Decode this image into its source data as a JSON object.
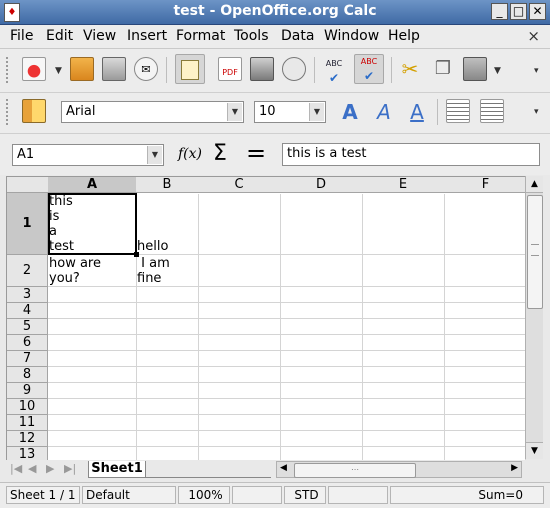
{
  "window": {
    "title": "test - OpenOffice.org Calc",
    "app_icon_label": "♦"
  },
  "menu": [
    "File",
    "Edit",
    "View",
    "Insert",
    "Format",
    "Tools",
    "Data",
    "Window",
    "Help"
  ],
  "menu_close": "×",
  "formatting": {
    "font_name": "Arial",
    "font_size": "10"
  },
  "formula_bar": {
    "name_box": "A1",
    "function_wizard_label": "f(x)",
    "sum_label": "Σ",
    "equals_label": "=",
    "input_value": "this is a test"
  },
  "columns": [
    "A",
    "B",
    "C",
    "D",
    "E",
    "F"
  ],
  "rows": [
    "1",
    "2",
    "3",
    "4",
    "5",
    "6",
    "7",
    "8",
    "9",
    "10",
    "11",
    "12",
    "13"
  ],
  "cells": {
    "A1": "this\nis\na\ntest",
    "B1": "hello",
    "A2": "how are\nyou?",
    "B2": " I am\nfine"
  },
  "sheet_tabs": [
    "Sheet1"
  ],
  "status": {
    "sheet": "Sheet 1 / 1",
    "page_style": "Default",
    "zoom": "100%",
    "mode": "STD",
    "sum": "Sum=0"
  },
  "icons": [
    "new-document-icon",
    "open-icon",
    "save-icon",
    "email-icon",
    "edit-file-icon",
    "export-pdf-icon",
    "print-icon",
    "page-preview-icon",
    "spellcheck-icon",
    "autospellcheck-icon",
    "cut-icon",
    "copy-icon",
    "paste-icon",
    "styles-icon",
    "bold-icon",
    "italic-icon",
    "underline-icon",
    "align-left-icon",
    "align-center-icon"
  ],
  "colors": {
    "title_bar": "#4f7ab3",
    "selected_header": "#c8c8c8",
    "selected_cell_border": "#000000"
  }
}
